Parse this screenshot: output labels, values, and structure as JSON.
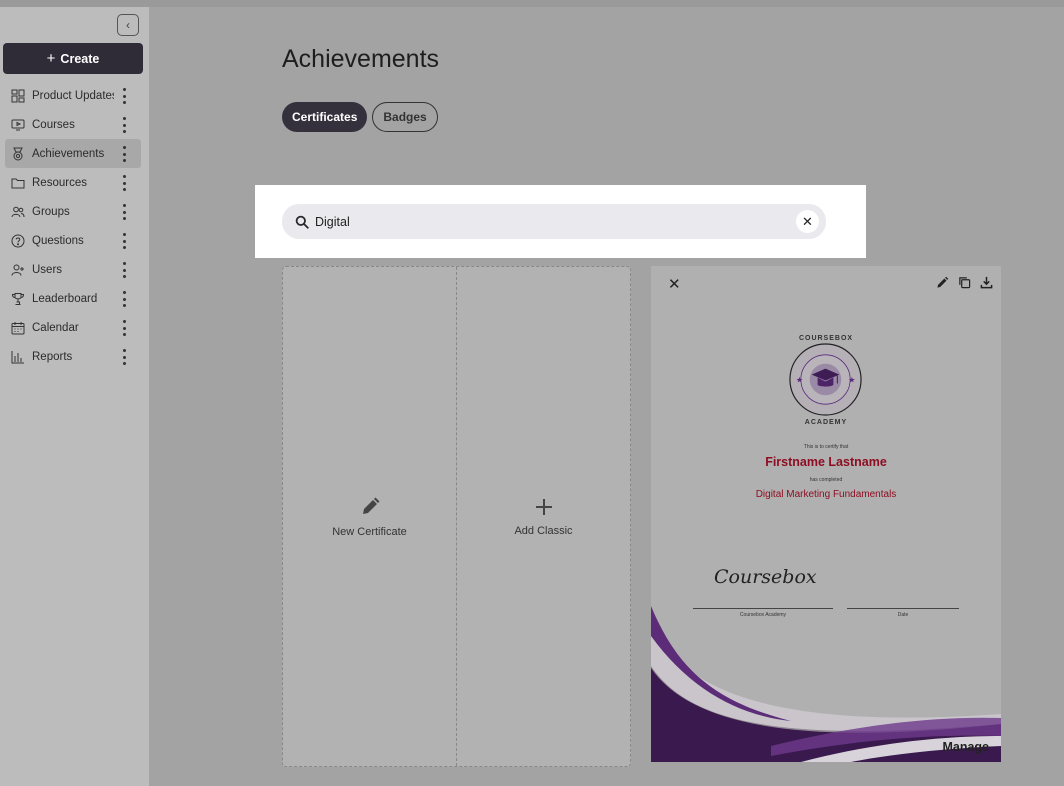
{
  "sidebar": {
    "create_label": "Create",
    "items": [
      {
        "label": "Product Updates",
        "icon": "dashboard-icon"
      },
      {
        "label": "Courses",
        "icon": "play-screen-icon"
      },
      {
        "label": "Achievements",
        "icon": "medal-icon",
        "active": true
      },
      {
        "label": "Resources",
        "icon": "folder-icon"
      },
      {
        "label": "Groups",
        "icon": "people-icon"
      },
      {
        "label": "Questions",
        "icon": "question-icon"
      },
      {
        "label": "Users",
        "icon": "add-user-icon"
      },
      {
        "label": "Leaderboard",
        "icon": "trophy-icon"
      },
      {
        "label": "Calendar",
        "icon": "calendar-icon"
      },
      {
        "label": "Reports",
        "icon": "bar-chart-icon"
      }
    ]
  },
  "main": {
    "title": "Achievements",
    "tabs": [
      {
        "label": "Certificates",
        "active": true
      },
      {
        "label": "Badges",
        "active": false
      }
    ],
    "search": {
      "value": "Digital"
    },
    "cards": {
      "new_certificate": "New Certificate",
      "add_classic": "Add Classic"
    },
    "preview": {
      "seal_top": "COURSEBOX",
      "seal_bottom": "ACADEMY",
      "certify_text": "This is to certify that",
      "recipient": "Firstname Lastname",
      "completed_text": "has completed",
      "course": "Digital Marketing Fundamentals",
      "signature": "Coursebox",
      "signer_caption": "Coursebox Academy",
      "date_caption": "Date",
      "manage_label": "Manage"
    }
  },
  "colors": {
    "brand_dark": "#2f2c38",
    "accent_purple": "#5b2a7a",
    "cert_red": "#8d0e22"
  }
}
